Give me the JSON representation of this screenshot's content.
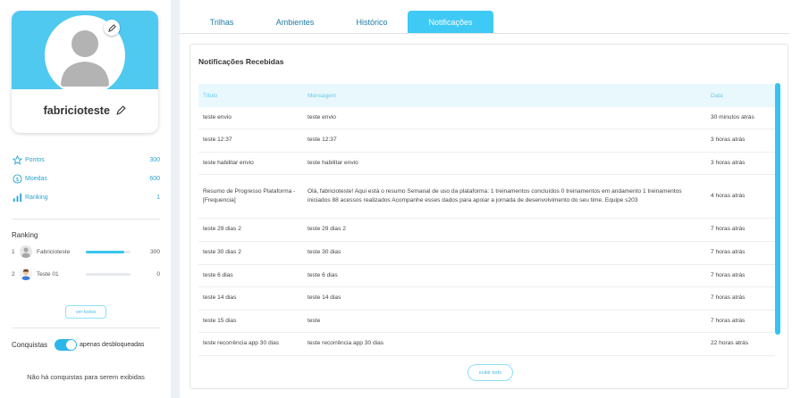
{
  "profile": {
    "username": "fabricioteste"
  },
  "stats": [
    {
      "label": "Pontos",
      "value": "300",
      "icon": "star-icon"
    },
    {
      "label": "Moedas",
      "value": "600",
      "icon": "coin-icon"
    },
    {
      "label": "Ranking",
      "value": "1",
      "icon": "bar-chart-icon"
    }
  ],
  "ranking": {
    "title": "Ranking",
    "entries": [
      {
        "position": "1",
        "name": "Fabricioteste",
        "score": "300",
        "progress": 0.85
      },
      {
        "position": "2",
        "name": "Teste 01",
        "score": "0",
        "progress": 0
      }
    ],
    "see_all_label": "ver todos"
  },
  "conquistas": {
    "title": "Conquistas",
    "toggle_label": "apenas desbloqueadas",
    "toggle_on": true,
    "empty_message": "Não há conquistas para serem exibidas"
  },
  "tabs": [
    {
      "label": "Trilhas",
      "active": false
    },
    {
      "label": "Ambientes",
      "active": false
    },
    {
      "label": "Histórico",
      "active": false
    },
    {
      "label": "Notificações",
      "active": true
    }
  ],
  "notifications": {
    "title": "Notificações Recebidas",
    "columns": [
      "Título",
      "Mensagem",
      "Data"
    ],
    "rows": [
      {
        "title": "teste envio",
        "message": "teste envio",
        "date": "30 minutos atrás"
      },
      {
        "title": "teste 12:37",
        "message": "teste 12:37",
        "date": "3 horas atrás"
      },
      {
        "title": "teste habilitar envio",
        "message": "teste habilitar envio",
        "date": "3 horas atrás"
      },
      {
        "title": "Resumo de Progresso Plataforma - [Frequencia]",
        "message": "Olá, fabricioteste! Aqui está o resumo Semanal de uso da plataforma: 1 treinamentos concluídos 0 treinamentos em andamento 1 treinamentos iniciados 88 acessos realizados Acompanhe esses dados para apoiar a jornada de desenvolvimento do seu time. Equipe s203",
        "date": "4 horas atrás"
      },
      {
        "title": "teste 29 dias 2",
        "message": "teste 29 dias 2",
        "date": "7 horas atrás"
      },
      {
        "title": "teste 30 dias 2",
        "message": "teste 30 dias",
        "date": "7 horas atrás"
      },
      {
        "title": "teste 6 dias",
        "message": "teste 6 dias",
        "date": "7 horas atrás"
      },
      {
        "title": "teste 14 dias",
        "message": "teste 14 dias",
        "date": "7 horas atrás"
      },
      {
        "title": "teste 15 dias",
        "message": "teste",
        "date": "7 horas atrás"
      },
      {
        "title": "teste recorrência app 30 dias",
        "message": "teste recorrência app 30 dias",
        "date": "22 horas atrás"
      }
    ],
    "show_all_label": "exibir todo"
  },
  "colors": {
    "accent": "#3fcaf5",
    "link": "#1d7aa6",
    "header_bg": "#e9f8fd"
  }
}
